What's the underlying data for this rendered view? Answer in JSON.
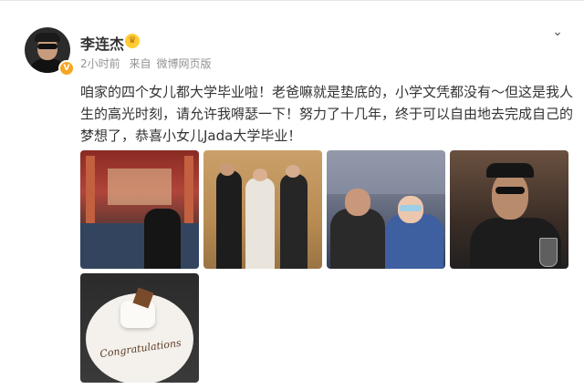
{
  "post": {
    "author": "李连杰",
    "verified_badge": "V",
    "time": "2小时前",
    "source_prefix": "来自",
    "source": "微博网页版",
    "text": "咱家的四个女儿都大学毕业啦！老爸嘛就是垫底的，小学文凭都没有～但这是我人生的高光时刻，请允许我嘚瑟一下！努力了十几年，终于可以自由地去完成自己的梦想了，恭喜小女儿Jada大学毕业！",
    "plate_text": "Congratulations"
  },
  "icons": {
    "crown": "crown-icon",
    "more": "chevron-down-icon"
  },
  "colors": {
    "name": "#333333",
    "meta": "#939393",
    "badge": "#f5a623"
  }
}
